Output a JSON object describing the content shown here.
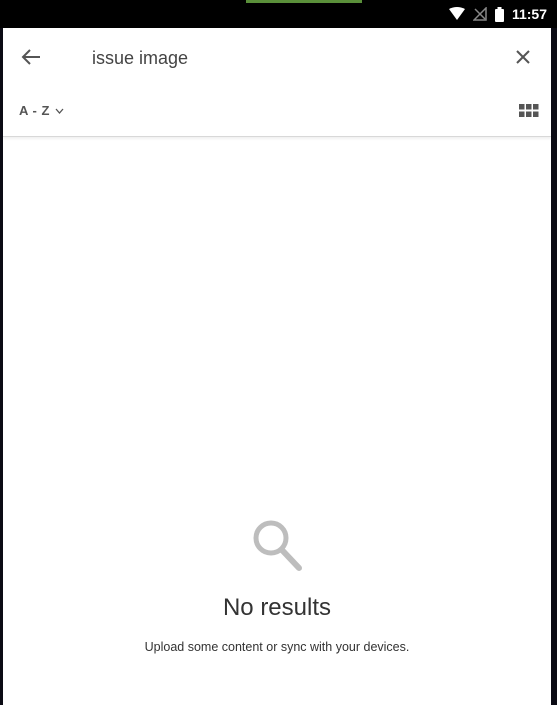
{
  "status_bar": {
    "time": "11:57",
    "icons": [
      "wifi-icon",
      "no-signal-icon",
      "battery-icon"
    ]
  },
  "toolbar": {
    "back_icon": "arrow-left-icon",
    "search_value": "issue image",
    "clear_icon": "close-icon"
  },
  "sort": {
    "label": "A - Z",
    "chevron_icon": "chevron-down-icon",
    "view_icon": "grid-view-icon"
  },
  "empty_state": {
    "icon": "search-icon",
    "title": "No results",
    "subtitle": "Upload some content or sync with your devices."
  },
  "colors": {
    "status_accent": "#5a8f3a",
    "icon_gray": "#555555",
    "empty_icon_gray": "#bdbdbd"
  }
}
